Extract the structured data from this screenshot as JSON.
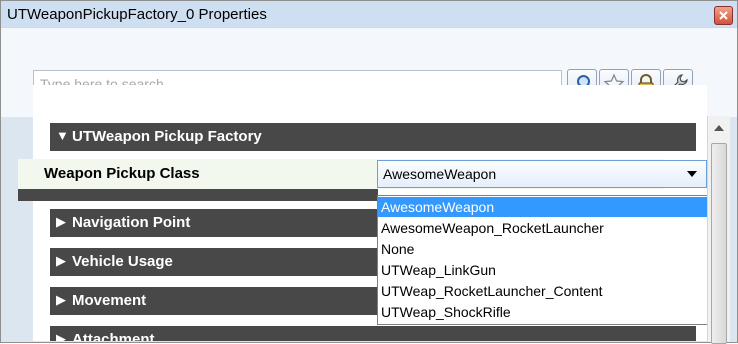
{
  "window": {
    "title": "UTWeaponPickupFactory_0 Properties"
  },
  "search": {
    "placeholder": "Type here to search"
  },
  "toolbar": {
    "icons": [
      "search-icon",
      "star-icon",
      "lock-icon",
      "wrench-icon"
    ]
  },
  "categories": [
    {
      "label": "UTWeapon Pickup Factory",
      "arrow": "▼"
    },
    {
      "label": "Navigation Point",
      "arrow": "▶"
    },
    {
      "label": "Vehicle Usage",
      "arrow": "▶"
    },
    {
      "label": "Movement",
      "arrow": "▶"
    },
    {
      "label": "Attachment",
      "arrow": "▶"
    }
  ],
  "property": {
    "label": "Weapon Pickup Class",
    "value": "AwesomeWeapon",
    "options": [
      "AwesomeWeapon",
      "AwesomeWeapon_RocketLauncher",
      "None",
      "UTWeap_LinkGun",
      "UTWeap_RocketLauncher_Content",
      "UTWeap_ShockRifle"
    ],
    "selected_index": 0
  },
  "colors": {
    "category_header": "#484848",
    "selection": "#3399ff"
  }
}
